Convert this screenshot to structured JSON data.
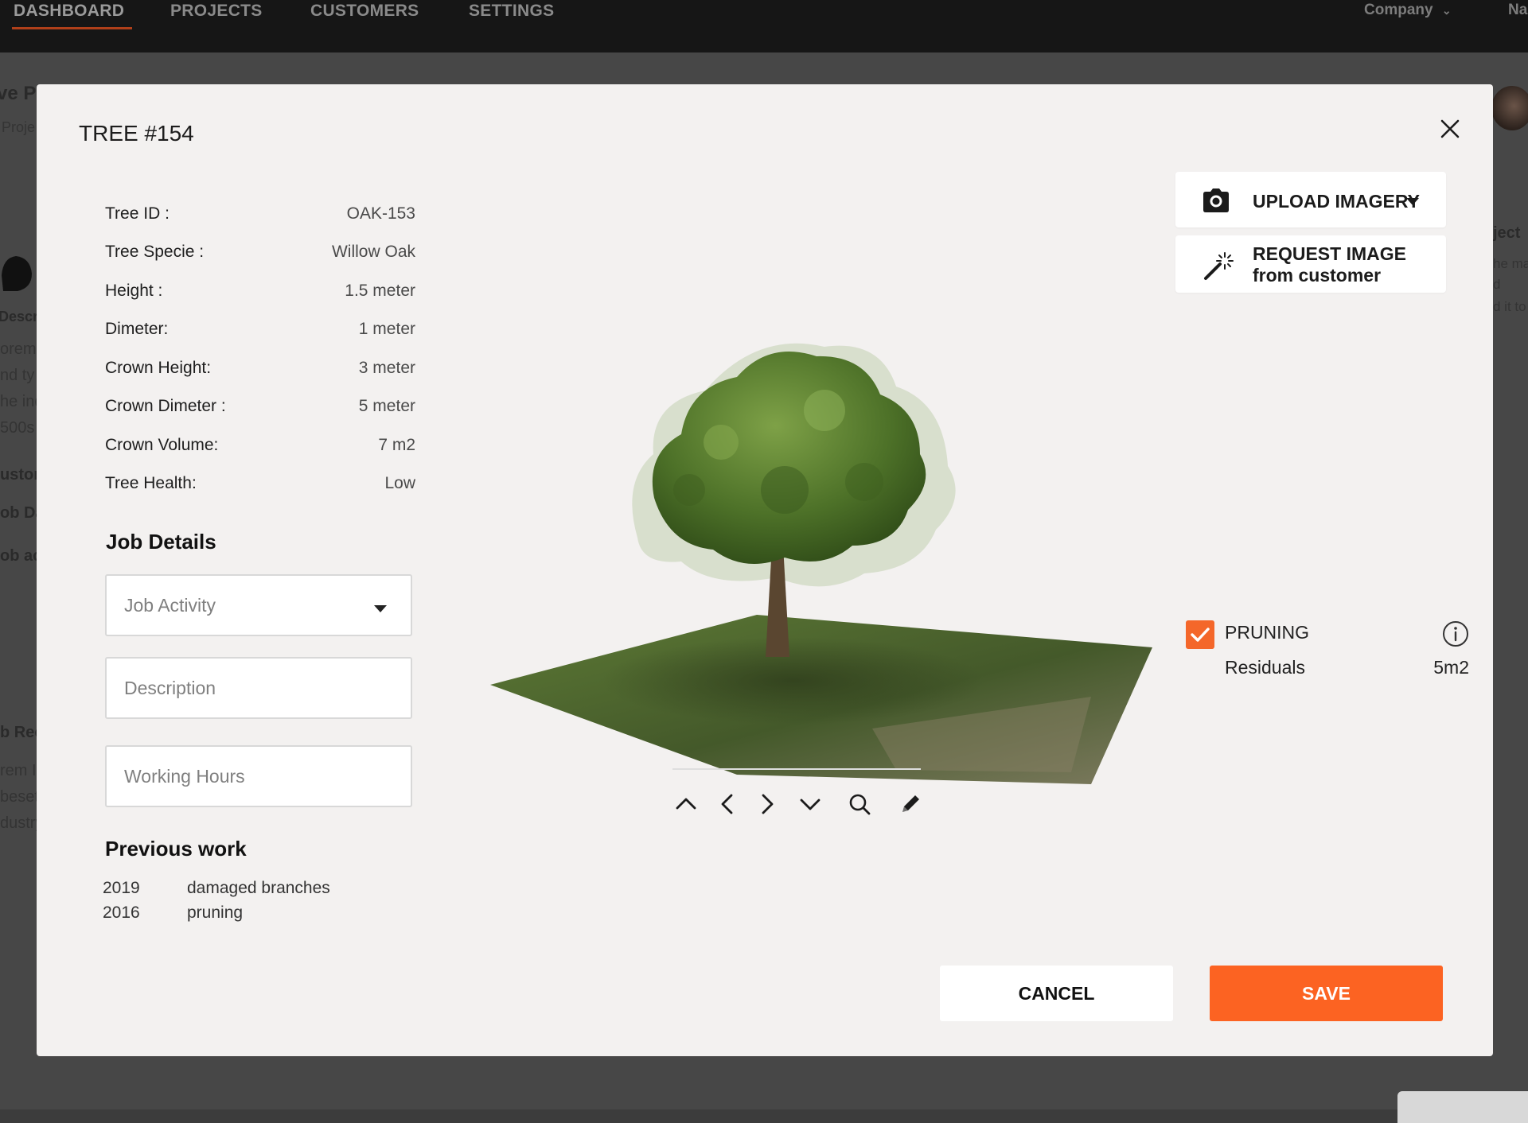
{
  "topnav": {
    "tabs": [
      "DASHBOARD",
      "PROJECTS",
      "CUSTOMERS",
      "SETTINGS"
    ],
    "company_label": "Company",
    "user_label": "Na"
  },
  "background": {
    "fragments": [
      "ve Pr",
      "Proje",
      "ject",
      "Descri",
      "orem",
      "nd ty",
      "he ind",
      "500s",
      "uston",
      "ob Da",
      "ob ac",
      "b Rec",
      "rem Ip",
      "beset",
      "dustry",
      "he ma",
      "d",
      "d it to t"
    ]
  },
  "modal": {
    "title": "TREE #154",
    "properties": [
      {
        "label": "Tree ID :",
        "value": "OAK-153"
      },
      {
        "label": "Tree Specie :",
        "value": "Willow Oak"
      },
      {
        "label": "Height :",
        "value": "1.5 meter"
      },
      {
        "label": "Dimeter:",
        "value": "1 meter"
      },
      {
        "label": "Crown Height:",
        "value": "3 meter"
      },
      {
        "label": "Crown Dimeter :",
        "value": "5 meter"
      },
      {
        "label": "Crown Volume:",
        "value": "7 m2"
      },
      {
        "label": "Tree Health:",
        "value": "Low"
      }
    ],
    "job_details": {
      "heading": "Job Details",
      "activity_placeholder": "Job Activity",
      "description_placeholder": "Description",
      "hours_placeholder": "Working Hours"
    },
    "previous_work": {
      "heading": "Previous work",
      "items": [
        {
          "year": "2019",
          "task": "damaged branches"
        },
        {
          "year": "2016",
          "task": "pruning"
        }
      ]
    },
    "upload_label": "UPLOAD IMAGERY",
    "request_label_1": "REQUEST IMAGE",
    "request_label_2": "from customer",
    "pruning": {
      "label": "PRUNING",
      "checked": true
    },
    "residuals": {
      "label": "Residuals",
      "value": "5m2"
    },
    "cancel_label": "CANCEL",
    "save_label": "SAVE"
  },
  "colors": {
    "accent": "#fc6322",
    "nav_bg": "#161616",
    "modal_bg": "#f3f1f0"
  },
  "icons": {
    "close": "close-icon",
    "camera": "camera-icon",
    "wand": "magic-wand-icon",
    "info": "info-icon",
    "up": "chevron-up-icon",
    "left": "chevron-left-icon",
    "right": "chevron-right-icon",
    "down": "chevron-down-icon",
    "zoom": "search-icon",
    "edit": "pencil-icon"
  }
}
